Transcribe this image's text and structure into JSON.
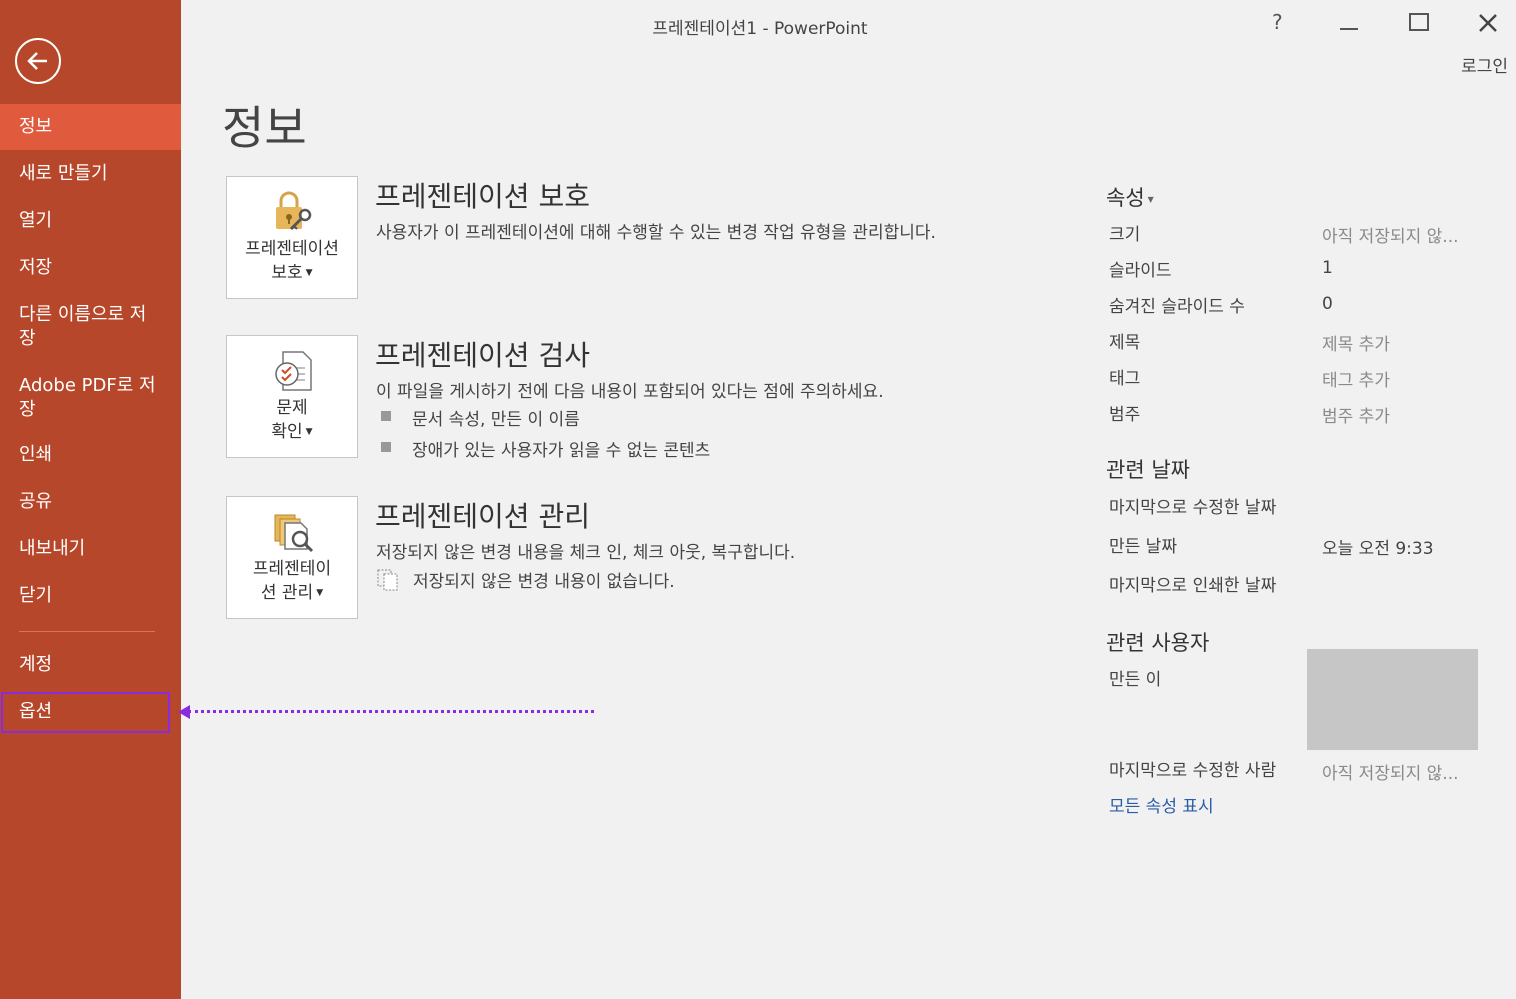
{
  "window": {
    "title": "프레젠테이션1 - PowerPoint",
    "help": "?",
    "minimize": "—",
    "maximize": "☐",
    "close": "✕",
    "login": "로그인"
  },
  "sidebar": {
    "items": [
      {
        "label": "정보"
      },
      {
        "label": "새로 만들기"
      },
      {
        "label": "열기"
      },
      {
        "label": "저장"
      },
      {
        "label": "다른 이름으로 저\n장"
      },
      {
        "label": "Adobe PDF로 저\n장"
      },
      {
        "label": "인쇄"
      },
      {
        "label": "공유"
      },
      {
        "label": "내보내기"
      },
      {
        "label": "닫기"
      },
      {
        "label": "계정"
      },
      {
        "label": "옵션"
      }
    ],
    "bg_color": "#b7472a",
    "active_color": "#e05a3d"
  },
  "main": {
    "title": "정보",
    "sections": [
      {
        "tile_label_1": "프레젠테이션",
        "tile_label_2": "보호",
        "heading": "프레젠테이션 보호",
        "desc": "사용자가 이 프레젠테이션에 대해 수행할 수 있는 변경 작업 유형을 관리합니다."
      },
      {
        "tile_label_1": "문제",
        "tile_label_2": "확인",
        "heading": "프레젠테이션 검사",
        "desc": "이 파일을 게시하기 전에 다음 내용이 포함되어 있다는 점에 주의하세요.",
        "bullets": [
          "문서 속성, 만든 이 이름",
          "장애가 있는 사용자가 읽을 수 없는 콘텐츠"
        ]
      },
      {
        "tile_label_1": "프레젠테이",
        "tile_label_2": "션 관리",
        "heading": "프레젠테이션 관리",
        "desc": "저장되지 않은 변경 내용을 체크 인, 체크 아웃, 복구합니다.",
        "note": "저장되지 않은 변경 내용이 없습니다."
      }
    ]
  },
  "properties": {
    "heading": "속성",
    "rows": [
      {
        "label": "크기",
        "value": "아직 저장되지 않..."
      },
      {
        "label": "슬라이드",
        "value": "1"
      },
      {
        "label": "숨겨진 슬라이드 수",
        "value": "0"
      },
      {
        "label": "제목",
        "value": "제목 추가"
      },
      {
        "label": "태그",
        "value": "태그 추가"
      },
      {
        "label": "범주",
        "value": "범주 추가"
      }
    ],
    "dates_heading": "관련 날짜",
    "dates": [
      {
        "label": "마지막으로 수정한 날짜",
        "value": ""
      },
      {
        "label": "만든 날짜",
        "value": "오늘 오전 9:33"
      },
      {
        "label": "마지막으로 인쇄한 날짜",
        "value": ""
      }
    ],
    "people_heading": "관련 사용자",
    "author_label": "만든 이",
    "last_modified_by_label": "마지막으로 수정한 사람",
    "last_modified_by_value": "아직 저장되지 않...",
    "show_all_link": "모든 속성 표시"
  },
  "annotation": {
    "color": "#8a2be2"
  }
}
